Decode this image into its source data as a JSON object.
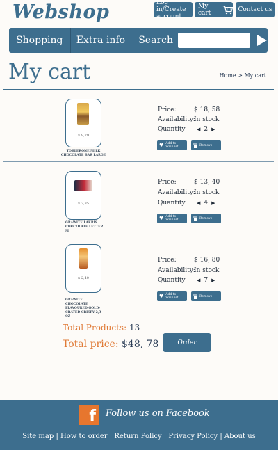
{
  "header": {
    "logo": "Webshop",
    "login_label": "Log in/Create account",
    "mycart_label": "My cart",
    "contact_label": "Contact us"
  },
  "nav": {
    "shopping": "Shopping",
    "extra_info": "Extra info",
    "search_label": "Search",
    "search_value": ""
  },
  "page": {
    "title": "My cart",
    "breadcrumb_home": "Home",
    "breadcrumb_sep": ">",
    "breadcrumb_current": "My cart"
  },
  "labels": {
    "price": "Price:",
    "availability": "Availability:",
    "quantity": "Quantity",
    "wishlist": "Add to Wishlist",
    "remove": "Remove"
  },
  "products": [
    {
      "name": "TOBLERONE MILK CHOCOLATE BAR LARGE",
      "card_price": "$ 9,29",
      "price": "$ 18, 58",
      "availability": "In stock",
      "quantity": "2"
    },
    {
      "name": "GRAWITE LAKRIS CHOCOLATE LETTER M",
      "card_price": "$ 3,35",
      "price": "$ 13, 40",
      "availability": "In stock",
      "quantity": "4"
    },
    {
      "name": "GRAWITE CHOCOLATE FLAVOURED GOLD-CRATED CRISPY 2,3 OZ",
      "card_price": "$ 2,40",
      "price": "$ 16, 80",
      "availability": "In stock",
      "quantity": "7"
    }
  ],
  "totals": {
    "products_label": "Total Products:",
    "products_value": "13",
    "price_label": "Total price:",
    "price_value": "$48, 78",
    "order_label": "Order"
  },
  "footer": {
    "follow": "Follow us on Facebook",
    "links": [
      "Site map",
      "How to order",
      "Return Policy",
      "Privacy Policy",
      "About us"
    ],
    "separator": "|"
  },
  "colors": {
    "accent": "#3d6e8e",
    "orange": "#e07b38",
    "facebook": "#e7762e"
  }
}
